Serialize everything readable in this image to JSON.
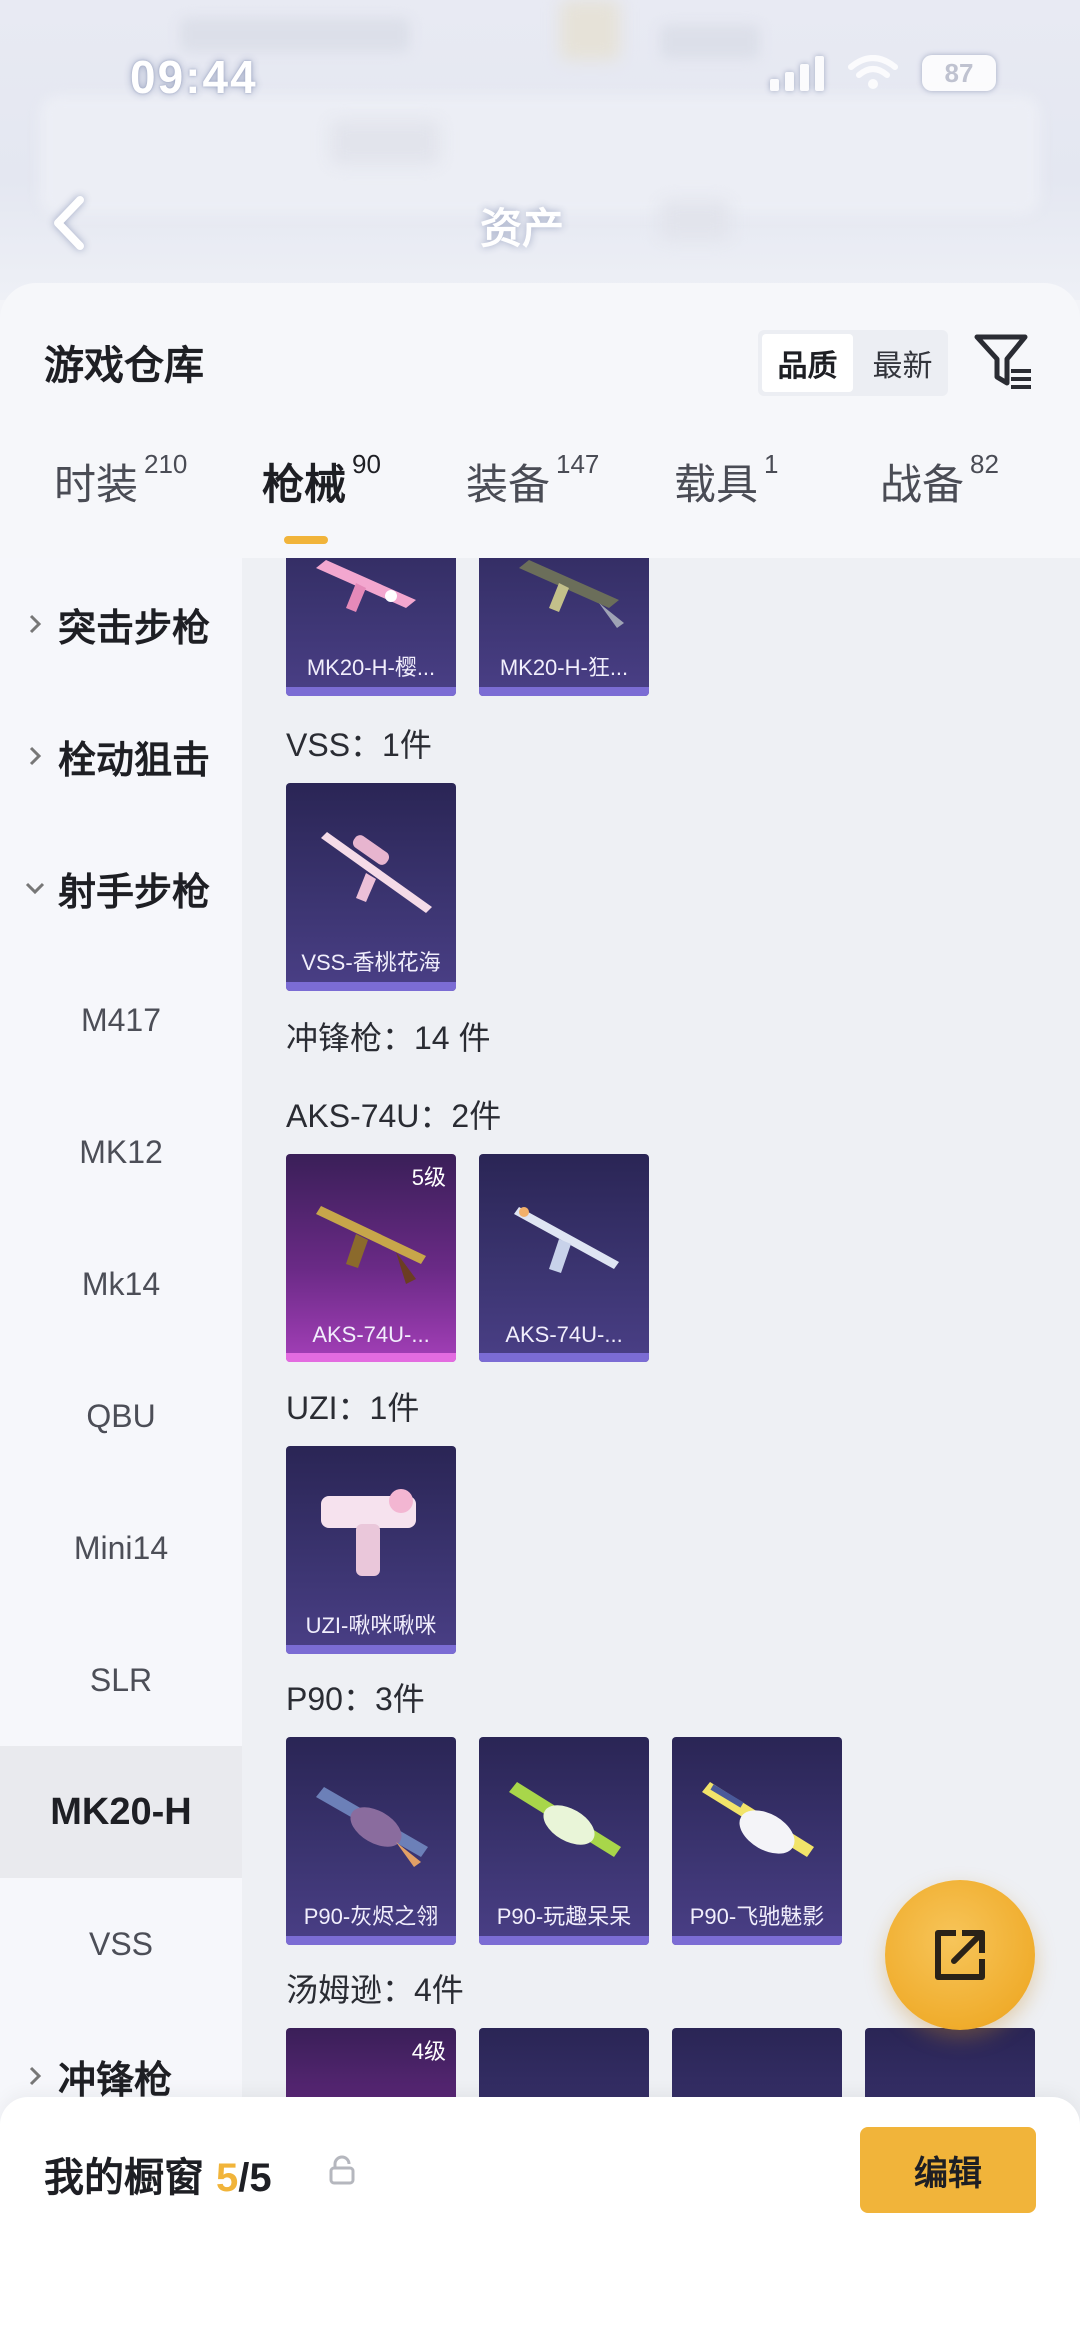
{
  "status_bar": {
    "time": "09:44",
    "battery": "87"
  },
  "header": {
    "title": "资产"
  },
  "sheet": {
    "title": "游戏仓库",
    "sort_options": [
      "品质",
      "最新"
    ],
    "active_sort": "品质"
  },
  "tabs": [
    {
      "label": "时装",
      "count": "210"
    },
    {
      "label": "枪械",
      "count": "90",
      "active": true
    },
    {
      "label": "装备",
      "count": "147"
    },
    {
      "label": "载具",
      "count": "1"
    },
    {
      "label": "战备",
      "count": "82"
    }
  ],
  "sidebar": {
    "items": [
      {
        "label": "突击步枪",
        "type": "group",
        "expanded": false
      },
      {
        "label": "栓动狙击",
        "type": "group",
        "expanded": false
      },
      {
        "label": "射手步枪",
        "type": "group",
        "expanded": true
      },
      {
        "label": "M417",
        "type": "sub"
      },
      {
        "label": "MK12",
        "type": "sub"
      },
      {
        "label": "Mk14",
        "type": "sub"
      },
      {
        "label": "QBU",
        "type": "sub"
      },
      {
        "label": "Mini14",
        "type": "sub"
      },
      {
        "label": "SLR",
        "type": "sub"
      },
      {
        "label": "MK20-H",
        "type": "sub",
        "active": true
      },
      {
        "label": "VSS",
        "type": "sub"
      },
      {
        "label": "冲锋枪",
        "type": "group",
        "expanded": false
      }
    ]
  },
  "content": {
    "top_cards": [
      {
        "name": "MK20-H-樱...",
        "icon": "pink-rifle"
      },
      {
        "name": "MK20-H-狂...",
        "icon": "dark-rifle"
      }
    ],
    "sections": [
      {
        "label": "VSS：1件",
        "cards": [
          {
            "name": "VSS-香桃花海",
            "icon": "pink-sniper"
          }
        ]
      },
      {
        "label": "冲锋枪：14 件",
        "cards": []
      },
      {
        "label": "AKS-74U：2件",
        "cards": [
          {
            "name": "AKS-74U-...",
            "level": "5级",
            "style": "pink",
            "icon": "gold-smg"
          },
          {
            "name": "AKS-74U-...",
            "icon": "white-smg"
          }
        ]
      },
      {
        "label": "UZI：1件",
        "cards": [
          {
            "name": "UZI-啾咪啾咪",
            "icon": "pink-uzi"
          }
        ]
      },
      {
        "label": "P90：3件",
        "cards": [
          {
            "name": "P90-灰烬之翎",
            "icon": "blue-p90"
          },
          {
            "name": "P90-玩趣呆呆",
            "icon": "green-p90"
          },
          {
            "name": "P90-飞驰魅影",
            "icon": "yellow-p90"
          }
        ]
      },
      {
        "label": "汤姆逊：4件",
        "cards": [
          {
            "name": "",
            "level": "4级",
            "style": "pink"
          },
          {
            "name": ""
          },
          {
            "name": ""
          },
          {
            "name": ""
          }
        ]
      }
    ]
  },
  "bottom_bar": {
    "title": "我的橱窗",
    "current": "5",
    "separator": "/",
    "max": "5",
    "edit_label": "编辑"
  },
  "colors": {
    "accent": "#f1b43a",
    "card_bg": "#3b3470",
    "card_pink": "#a43fb8"
  }
}
